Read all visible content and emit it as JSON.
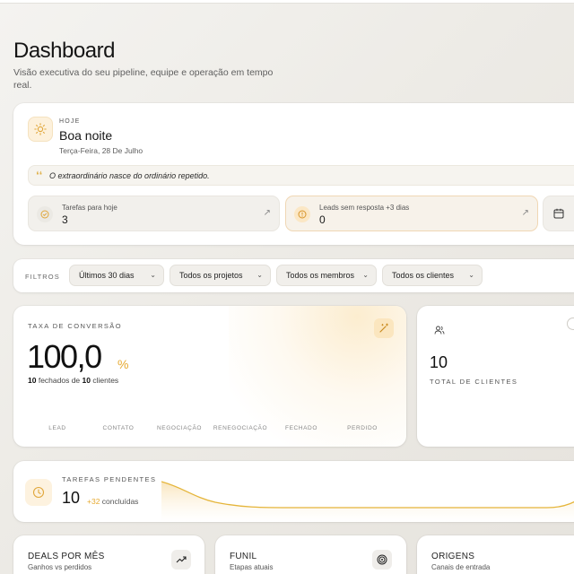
{
  "header": {
    "title": "Dashboard",
    "subtitle": "Visão executiva do seu pipeline, equipe e operação em tempo real."
  },
  "today": {
    "label": "HOJE",
    "greeting": "Boa noite",
    "date": "Terça-Feira, 28 De Julho",
    "quote": "O extraordinário nasce do ordinário repetido.",
    "metrics": [
      {
        "label": "Tarefas para hoje",
        "value": "3",
        "icon": "check-circle-icon"
      },
      {
        "label": "Leads sem resposta +3 dias",
        "value": "0",
        "icon": "alert-circle-icon"
      },
      {
        "label": "",
        "value": "",
        "icon": "calendar-icon"
      }
    ]
  },
  "filters": {
    "label": "FILTROS",
    "items": [
      "Últimos 30 dias",
      "Todos os projetos",
      "Todos os membros",
      "Todos os clientes"
    ]
  },
  "conversion": {
    "label": "TAXA DE CONVERSÃO",
    "value": "100,0",
    "unit": "%",
    "sub_closed": "10",
    "sub_mid": " fechados de ",
    "sub_total": "10",
    "sub_end": " clientes",
    "stages": [
      "LEAD",
      "CONTATO",
      "NEGOCIAÇÃO",
      "RENEGOCIAÇÃO",
      "FECHADO",
      "PERDIDO"
    ]
  },
  "clients": {
    "value": "10",
    "label": "TOTAL DE CLIENTES"
  },
  "tasks": {
    "label": "TAREFAS PENDENTES",
    "value": "10",
    "done_plus": "+32",
    "done_label": " concluídas"
  },
  "bottom": [
    {
      "title": "DEALS POR MÊS",
      "sub": "Ganhos vs perdidos",
      "icon": "trend-up-icon"
    },
    {
      "title": "FUNIL",
      "sub": "Etapas atuais",
      "icon": "target-icon"
    },
    {
      "title": "ORIGENS",
      "sub": "Canais de entrada",
      "icon": ""
    }
  ],
  "colors": {
    "accent": "#e6a92f",
    "accent_soft": "#fbe6bf",
    "background": "#edebe6"
  }
}
